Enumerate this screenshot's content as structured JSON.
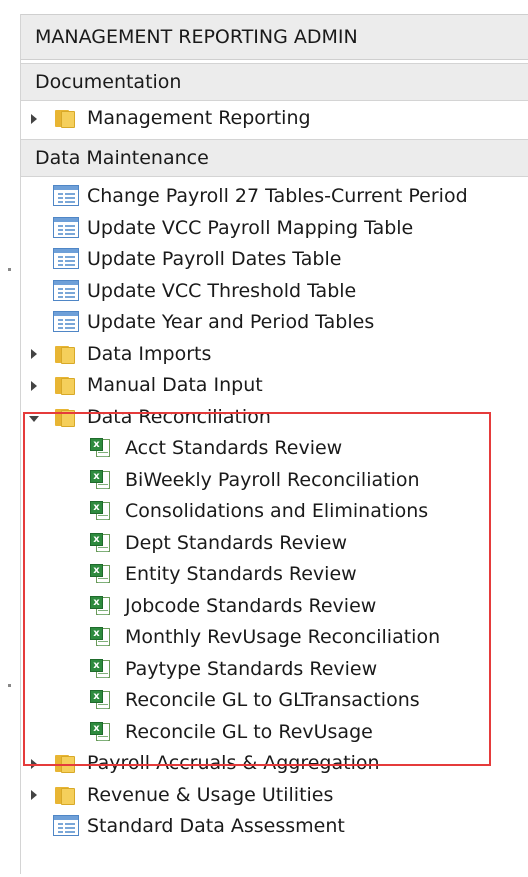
{
  "panel": {
    "title": "MANAGEMENT REPORTING ADMIN"
  },
  "sections": {
    "documentation": {
      "label": "Documentation",
      "items": [
        {
          "label": "Management Reporting",
          "type": "folder",
          "expanded": false
        }
      ]
    },
    "data_maintenance": {
      "label": "Data Maintenance",
      "items": [
        {
          "label": "Change Payroll 27 Tables-Current Period",
          "type": "form"
        },
        {
          "label": "Update VCC Payroll Mapping Table",
          "type": "form"
        },
        {
          "label": "Update Payroll Dates Table",
          "type": "form"
        },
        {
          "label": "Update VCC Threshold Table",
          "type": "form"
        },
        {
          "label": "Update Year and Period Tables",
          "type": "form"
        },
        {
          "label": "Data Imports",
          "type": "folder",
          "expanded": false
        },
        {
          "label": "Manual Data Input",
          "type": "folder",
          "expanded": false
        },
        {
          "label": "Data Reconciliation",
          "type": "folder",
          "expanded": true
        },
        {
          "label": "Acct Standards Review",
          "type": "excel"
        },
        {
          "label": "BiWeekly Payroll Reconciliation",
          "type": "excel"
        },
        {
          "label": "Consolidations and Eliminations",
          "type": "excel"
        },
        {
          "label": "Dept Standards Review",
          "type": "excel"
        },
        {
          "label": "Entity Standards Review",
          "type": "excel"
        },
        {
          "label": "Jobcode Standards Review",
          "type": "excel"
        },
        {
          "label": "Monthly RevUsage Reconciliation",
          "type": "excel"
        },
        {
          "label": "Paytype Standards Review",
          "type": "excel"
        },
        {
          "label": "Reconcile GL to GLTransactions",
          "type": "excel"
        },
        {
          "label": "Reconcile GL to RevUsage",
          "type": "excel"
        },
        {
          "label": "Payroll Accruals &  Aggregation",
          "type": "folder",
          "expanded": false
        },
        {
          "label": "Revenue & Usage Utilities",
          "type": "folder",
          "expanded": false
        },
        {
          "label": "Standard Data Assessment",
          "type": "form"
        }
      ]
    }
  },
  "highlight": {
    "color": "#e53b3b"
  },
  "icons": {
    "folder": "folder-icon",
    "form": "form-icon",
    "excel": "excel-icon",
    "expander": "chevron-icon"
  }
}
